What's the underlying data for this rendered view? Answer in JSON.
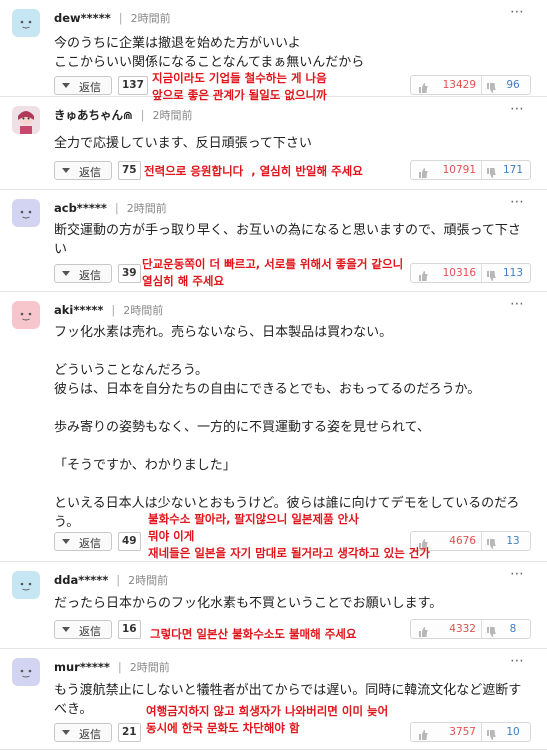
{
  "comments": [
    {
      "user": "dew*****",
      "time": "2時間前",
      "avatar": "blue",
      "text": "今のうちに企業は撤退を始めた方がいいよ\nここからいい関係になることなんてまぁ無いんだから",
      "reply": "返信",
      "replies": "137",
      "up": "13429",
      "down": "96",
      "translation": "지금이라도 기업들 철수하는 게 나음\n앞으로 좋은 관계가 될일도 없으니까"
    },
    {
      "user": "きゅあちゃん⋒",
      "time": "2時間前",
      "avatar": "photo",
      "text": "全力で応援しています、反日頑張って下さい",
      "reply": "返信",
      "replies": "75",
      "up": "10791",
      "down": "171",
      "translation": "전력으로 응원합니다  , 열심히 반일해 주세요"
    },
    {
      "user": "acb*****",
      "time": "2時間前",
      "avatar": "lav",
      "text": "断交運動の方が手っ取り早く、お互いの為になると思いますので、頑張って下さ\nい",
      "reply": "返信",
      "replies": "39",
      "up": "10316",
      "down": "113",
      "translation": "단교운동쪽이 더 빠르고, 서로를 위해서 좋을거 같으니\n열심히 해 주세요"
    },
    {
      "user": "aki*****",
      "time": "2時間前",
      "avatar": "pink",
      "text": "フッ化水素は売れ。売らないなら、日本製品は買わない。\n\nどういうことなんだろう。\n彼らは、日本を自分たちの自由にできるとでも、おもってるのだろうか。\n\n歩み寄りの姿勢もなく、一方的に不買運動する姿を見せられて、\n\n「そうですか、わかりました」\n\nといえる日本人は少ないとおもうけど。彼らは誰に向けてデモをしているのだろ\nう。",
      "reply": "返信",
      "replies": "49",
      "up": "4676",
      "down": "13",
      "translation": "불화수소 팔아라, 팔지않으니 일본제품 안사\n뭐야 이게\n재네들은 일본을 자기 맘대로 될거라고 생각하고 있는 건가"
    },
    {
      "user": "dda*****",
      "time": "2時間前",
      "avatar": "blue",
      "text": "だったら日本からのフッ化水素も不買ということでお願いします。",
      "reply": "返信",
      "replies": "16",
      "up": "4332",
      "down": "8",
      "translation": "그렇다면 일본산 불화수소도 불매해 주세요"
    },
    {
      "user": "mur*****",
      "time": "2時間前",
      "avatar": "lav",
      "text": "もう渡航禁止にしないと犠牲者が出てからでは遅い。同時に韓流文化など遮断す\nべき。",
      "reply": "返信",
      "replies": "21",
      "up": "3757",
      "down": "10",
      "translation": "여행금지하지 않고 희생자가 나와버리면 이미 늦어\n동시에 한국 문화도 차단해야 함"
    }
  ],
  "more_icon": "⋯",
  "colors": {
    "up": "#e05050",
    "down": "#3f7fc2",
    "translation": "#e0161c"
  }
}
